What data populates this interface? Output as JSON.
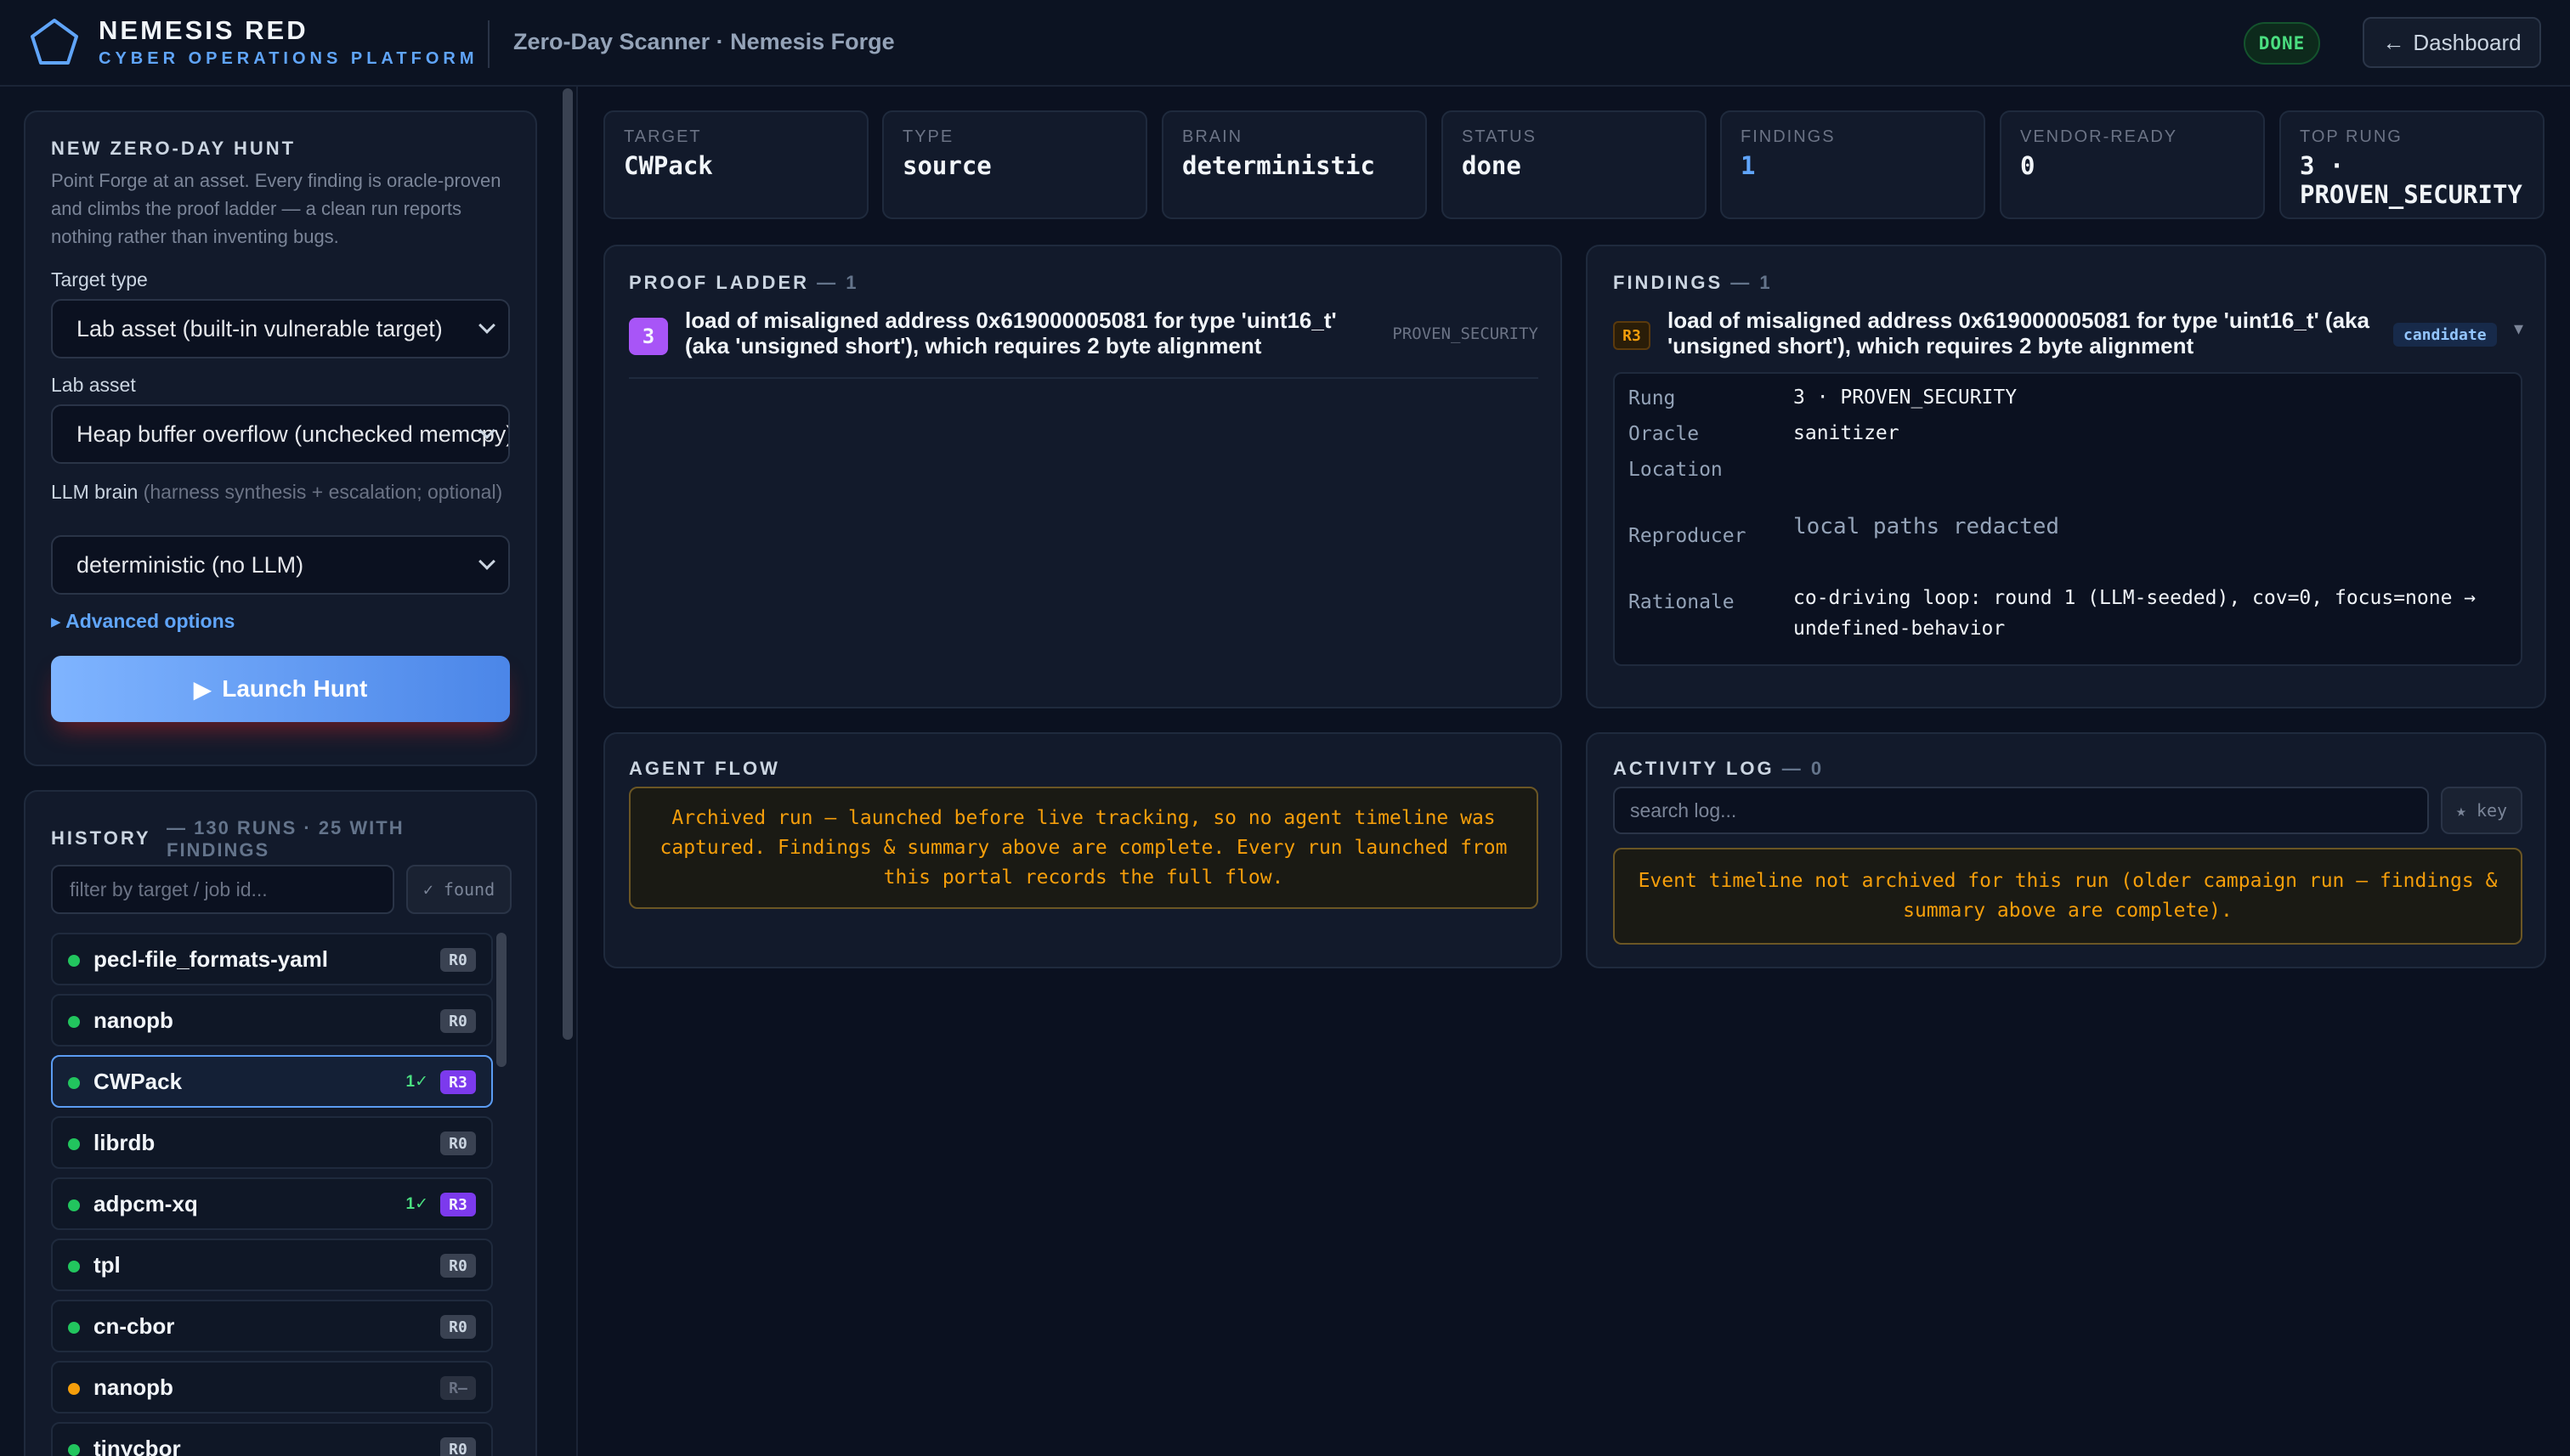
{
  "header": {
    "brand_title": "NEMESIS RED",
    "brand_subtitle": "CYBER OPERATIONS PLATFORM",
    "page_title": "Zero-Day Scanner · Nemesis Forge",
    "status_badge": "DONE",
    "dashboard_button": "Dashboard",
    "dashboard_icon": "←"
  },
  "hunt": {
    "heading": "NEW ZERO-DAY HUNT",
    "description": "Point Forge at an asset. Every finding is oracle-proven and climbs the proof ladder — a clean run reports nothing rather than inventing bugs.",
    "target_type_label": "Target type",
    "target_type_value": "Lab asset (built-in vulnerable target)",
    "lab_asset_label": "Lab asset",
    "lab_asset_value": "Heap buffer overflow (unchecked memcpy)",
    "llm_label": "LLM brain",
    "llm_label_note": "(harness synthesis + escalation; optional)",
    "llm_value": "deterministic (no LLM)",
    "advanced_link": "▸ Advanced options",
    "launch_button": "Launch Hunt",
    "launch_icon": "▶"
  },
  "history": {
    "heading": "HISTORY",
    "count": "— 130 RUNS · 25 WITH FINDINGS",
    "filter_placeholder": "filter by target / job id...",
    "found_button": "✓ found",
    "items": [
      {
        "name": "pecl-file_formats-yaml",
        "rung": "R0",
        "status": "green"
      },
      {
        "name": "nanopb",
        "rung": "R0",
        "status": "green"
      },
      {
        "name": "CWPack",
        "rung": "R3",
        "found": "1✓",
        "status": "green",
        "selected": true
      },
      {
        "name": "librdb",
        "rung": "R0",
        "status": "green"
      },
      {
        "name": "adpcm-xq",
        "rung": "R3",
        "found": "1✓",
        "status": "green"
      },
      {
        "name": "tpl",
        "rung": "R0",
        "status": "green"
      },
      {
        "name": "cn-cbor",
        "rung": "R0",
        "status": "green"
      },
      {
        "name": "nanopb",
        "rung": "R–",
        "status": "amber"
      },
      {
        "name": "tinycbor",
        "rung": "R0",
        "status": "green"
      }
    ]
  },
  "stats": [
    {
      "label": "TARGET",
      "value": "CWPack"
    },
    {
      "label": "TYPE",
      "value": "source"
    },
    {
      "label": "BRAIN",
      "value": "deterministic"
    },
    {
      "label": "STATUS",
      "value": "done"
    },
    {
      "label": "FINDINGS",
      "value": "1"
    },
    {
      "label": "VENDOR-READY",
      "value": "0"
    },
    {
      "label": "TOP RUNG",
      "value": "3 · PROVEN_SECURITY"
    }
  ],
  "proof_ladder": {
    "heading": "PROOF LADDER",
    "count": "— 1",
    "rung": "3",
    "title": "load of misaligned address 0x619000005081 for type 'uint16_t' (aka 'unsigned short'), which requires 2 byte alignment",
    "tag": "PROVEN_SECURITY"
  },
  "findings": {
    "heading": "FINDINGS",
    "count": "— 1",
    "rung_badge": "R3",
    "title": "load of misaligned address 0x619000005081 for type 'uint16_t' (aka 'unsigned short'), which requires 2 byte alignment",
    "candidate_badge": "candidate",
    "caret": "▾",
    "details": {
      "rung_label": "Rung",
      "rung_value": "3 · PROVEN_SECURITY",
      "oracle_label": "Oracle",
      "oracle_value": "sanitizer",
      "location_label": "Location",
      "location_value": "",
      "reproducer_label": "Reproducer",
      "reproducer_value": "local paths redacted",
      "rationale_label": "Rationale",
      "rationale_value": "co-driving loop: round 1 (LLM-seeded), cov=0, focus=none → undefined-behavior"
    }
  },
  "agent_flow": {
    "heading": "AGENT FLOW",
    "note": "Archived run — launched before live tracking, so no agent timeline was captured. Findings & summary above are complete. Every run launched from this portal records the full flow."
  },
  "activity_log": {
    "heading": "ACTIVITY LOG",
    "count": "— 0",
    "search_placeholder": "search log...",
    "key_button": "★ key",
    "note": "Event timeline not archived for this run (older campaign run — findings & summary above are complete)."
  }
}
